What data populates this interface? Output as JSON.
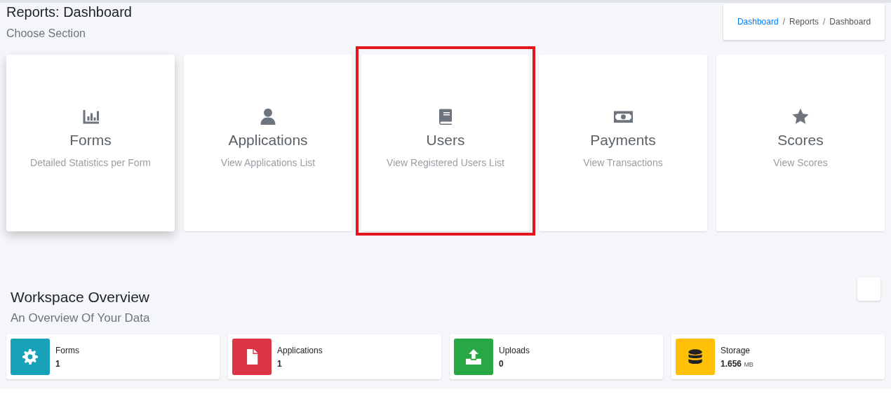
{
  "header": {
    "title": "Reports: Dashboard",
    "subtitle": "Choose Section"
  },
  "breadcrumb": {
    "separator": "/",
    "items": [
      {
        "label": "Dashboard",
        "link": true
      },
      {
        "label": "Reports",
        "link": false
      },
      {
        "label": "Dashboard",
        "link": false
      }
    ]
  },
  "sections": [
    {
      "title": "Forms",
      "subtitle": "Detailed Statistics per Form",
      "raised": true,
      "highlighted": false
    },
    {
      "title": "Applications",
      "subtitle": "View Applications List",
      "raised": false,
      "highlighted": false
    },
    {
      "title": "Users",
      "subtitle": "View Registered Users List",
      "raised": false,
      "highlighted": true
    },
    {
      "title": "Payments",
      "subtitle": "View Transactions",
      "raised": false,
      "highlighted": false
    },
    {
      "title": "Scores",
      "subtitle": "View Scores",
      "raised": false,
      "highlighted": false
    }
  ],
  "overview": {
    "title": "Workspace Overview",
    "subtitle": "An Overview Of Your Data",
    "stats": [
      {
        "label": "Forms",
        "value": "1",
        "color": "#17a2b8"
      },
      {
        "label": "Applications",
        "value": "1",
        "color": "#dc3545"
      },
      {
        "label": "Uploads",
        "value": "0",
        "color": "#28a745"
      },
      {
        "label": "Storage",
        "value": "1.656",
        "unit": "MB",
        "color": "#ffc107"
      }
    ]
  }
}
